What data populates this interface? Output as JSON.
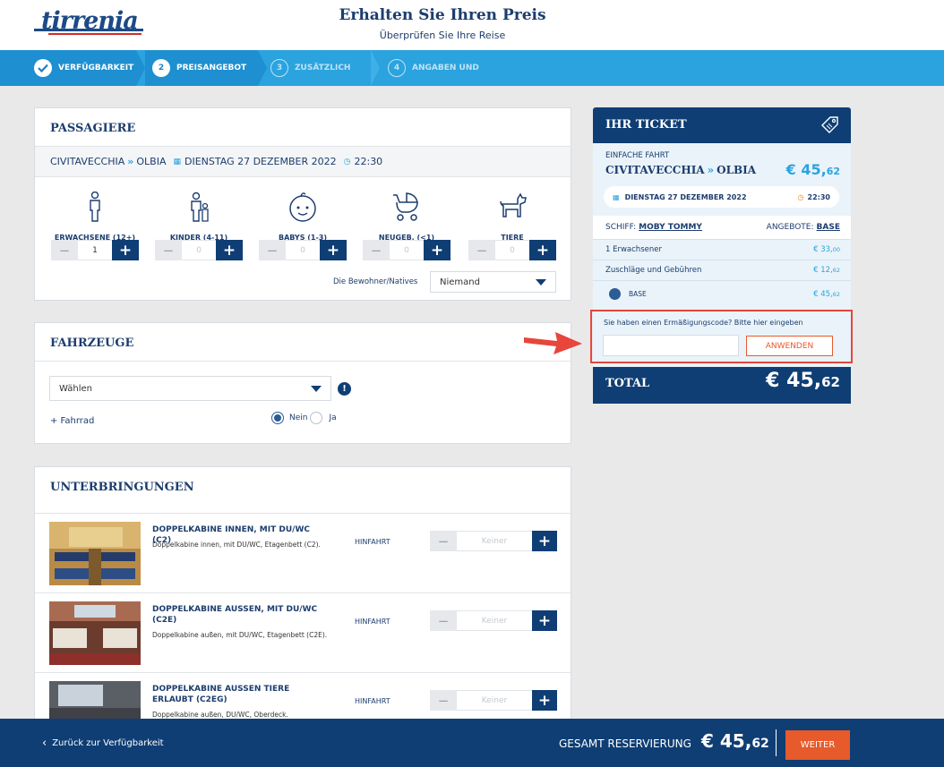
{
  "header": {
    "logo_text": "tirrenia",
    "title": "Erhalten Sie Ihren Preis",
    "subtitle": "Überprüfen Sie Ihre Reise"
  },
  "steps": [
    {
      "number": "✓",
      "label": "VERFÜGBARKEIT",
      "state": "done"
    },
    {
      "number": "2",
      "label": "PREISANGEBOT",
      "state": "current"
    },
    {
      "number": "3",
      "label": "ZUSÄTZLICH",
      "state": "upcoming"
    },
    {
      "number": "4",
      "label": "ANGABEN UND",
      "state": "upcoming"
    }
  ],
  "passengers": {
    "title": "PASSAGIERE",
    "route": {
      "from": "CIVITAVECCHIA",
      "to": "OLBIA",
      "date": "DIENSTAG 27 DEZEMBER 2022",
      "time": "22:30"
    },
    "types": [
      {
        "label": "ERWACHSENE (12+)",
        "value": "1",
        "icon": "adult-icon"
      },
      {
        "label": "KINDER (4-11)",
        "value": "0",
        "icon": "child-icon"
      },
      {
        "label": "BABYS (1-3)",
        "value": "0",
        "icon": "baby-icon"
      },
      {
        "label": "NEUGEB. (<1)",
        "value": "0",
        "icon": "stroller-icon"
      },
      {
        "label": "TIERE",
        "value": "0",
        "icon": "pet-icon"
      }
    ],
    "residents_label": "Die Bewohner/Natives",
    "residents_value": "Niemand"
  },
  "vehicles": {
    "title": "FAHRZEUGE",
    "select_value": "Wählen",
    "bike_label": "+ Fahrrad",
    "no_label": "Nein",
    "yes_label": "Ja"
  },
  "accommodations": {
    "title": "UNTERBRINGUNGEN",
    "items": [
      {
        "title": "DOPPELKABINE INNEN, MIT DU/WC (C2)",
        "desc": "Doppelkabine innen, mit DU/WC, Etagenbett (C2).",
        "direction": "HINFAHRT",
        "value": "Keiner"
      },
      {
        "title": "DOPPELKABINE AUSSEN, MIT DU/WC (C2E)",
        "desc": "Doppelkabine außen, mit DU/WC, Etagenbett (C2E).",
        "direction": "HINFAHRT",
        "value": "Keiner"
      },
      {
        "title": "DOPPELKABINE AUSSEN TIERE ERLAUBT (C2EG)",
        "desc": "Doppelkabine außen, DU/WC, Oberdeck.",
        "direction": "HINFAHRT",
        "value": "Keiner"
      }
    ]
  },
  "ticket": {
    "title": "IHR TICKET",
    "trip_type": "EINFACHE FAHRT",
    "from": "CIVITAVECCHIA",
    "to": "OLBIA",
    "price_main": "€ 45,",
    "price_cents": "62",
    "date": "DIENSTAG 27 DEZEMBER 2022",
    "time": "22:30",
    "ship_label": "SCHIFF:",
    "ship_name": "MOBY TOMMY",
    "offer_label": "ANGEBOTE:",
    "offer_name": "BASE",
    "lines": [
      {
        "label": "1 Erwachsener",
        "amount_main": "€ 33,",
        "amount_cents": "00"
      },
      {
        "label": "Zuschläge und Gebühren",
        "amount_main": "€ 12,",
        "amount_cents": "62"
      }
    ],
    "base_label": "BASE",
    "base_main": "€ 45,",
    "base_cents": "62",
    "discount_prompt": "Sie haben einen Ermäßigungscode? Bitte hier eingeben",
    "discount_placeholder": "",
    "apply_label": "ANWENDEN",
    "total_label": "TOTAL",
    "total_main": "€ 45,",
    "total_cents": "62"
  },
  "footer": {
    "back_label": "Zurück zur Verfügbarkeit",
    "total_label": "GESAMT RESERVIERUNG",
    "total_main": "€ 45,",
    "total_cents": "62",
    "next_label": "WEITER"
  },
  "colors": {
    "brand": "#0f3e74",
    "accent": "#2aa3df",
    "cta": "#e65a2b",
    "highlight": "#e3473b"
  }
}
